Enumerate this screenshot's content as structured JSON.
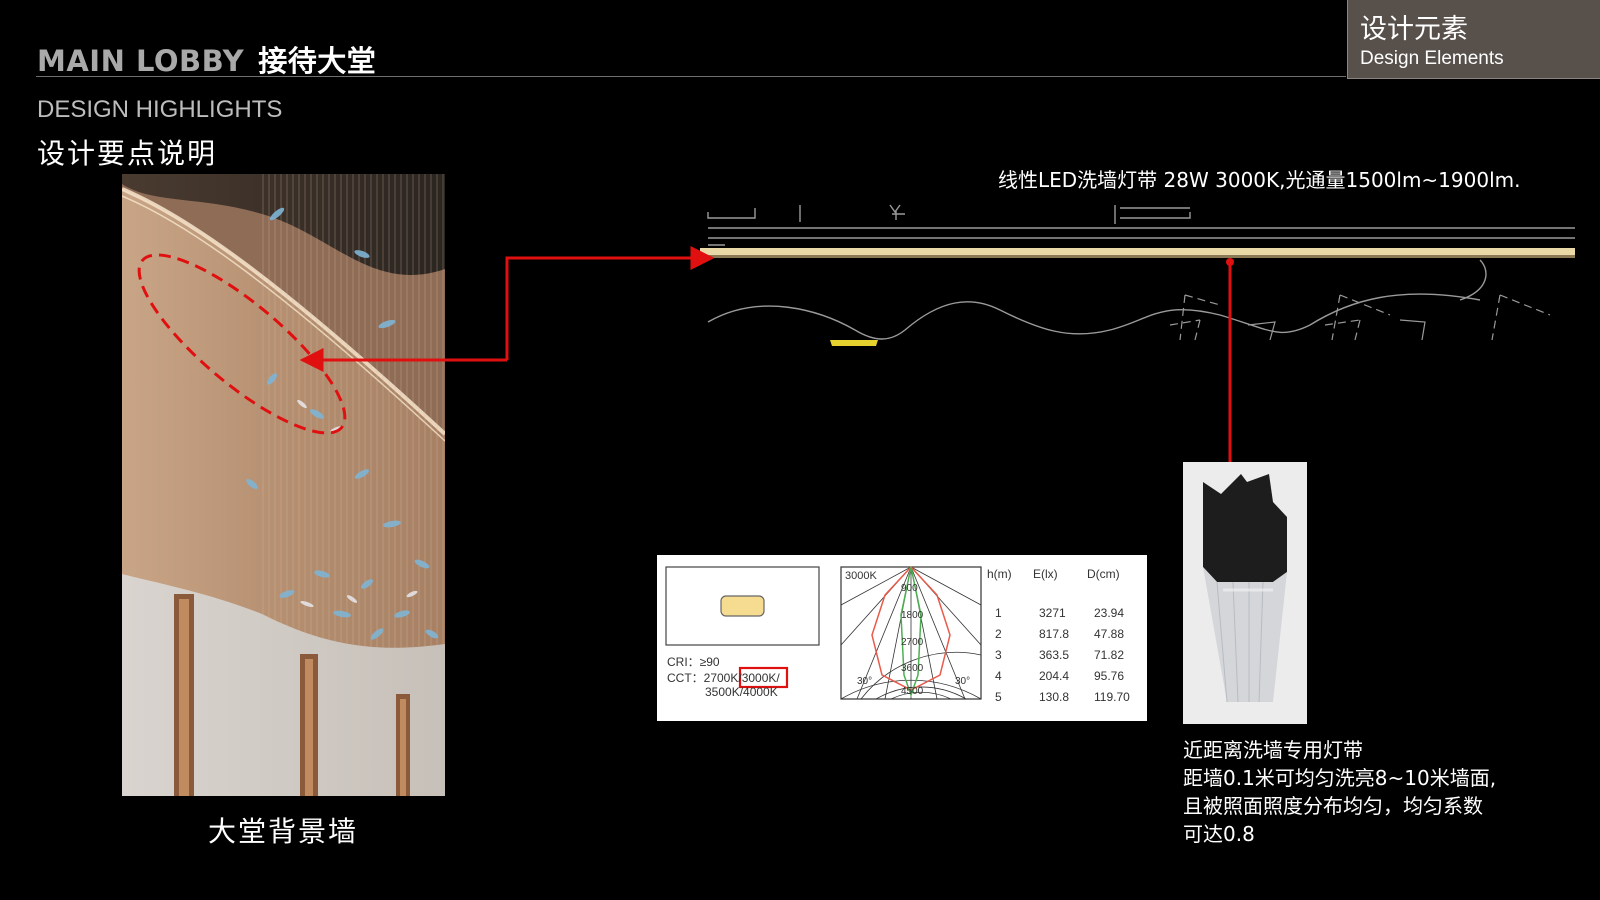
{
  "header": {
    "title_en": "MAIN LOBBY",
    "title_cn": "接待大堂"
  },
  "badge": {
    "cn": "设计元素",
    "en": "Design Elements"
  },
  "highlights": {
    "en": "DESIGN HIGHLIGHTS",
    "cn": "设计要点说明"
  },
  "photo": {
    "caption": "大堂背景墙"
  },
  "led": {
    "spec": "线性LED洗墙灯带 28W 3000K,光通量1500lm~1900lm."
  },
  "datasheet": {
    "cri": "CRI：≥90",
    "cct_prefix": "CCT：2700K/",
    "cct_highlight": "3000K/",
    "cct_line2": "3500K/4000K",
    "polar_label": "3000K",
    "polar_values": [
      "900",
      "1800",
      "2700",
      "3600",
      "4500"
    ],
    "polar_angles": [
      "30°",
      "30°"
    ],
    "table_headers": [
      "h(m)",
      "E(lx)",
      "D(cm)"
    ],
    "table_rows": [
      [
        "1",
        "3271",
        "23.94"
      ],
      [
        "2",
        "817.8",
        "47.88"
      ],
      [
        "3",
        "363.5",
        "71.82"
      ],
      [
        "4",
        "204.4",
        "95.76"
      ],
      [
        "5",
        "130.8",
        "119.70"
      ]
    ]
  },
  "product": {
    "desc": [
      "近距离洗墙专用灯带",
      "距墙0.1米可均匀洗亮8~10米墙面,",
      "且被照面照度分布均匀，均匀系数",
      "可达0.8"
    ]
  },
  "colors": {
    "accent_red": "#e01010",
    "led_strip": "#e8d9a6",
    "badge_bg": "#57504b"
  }
}
